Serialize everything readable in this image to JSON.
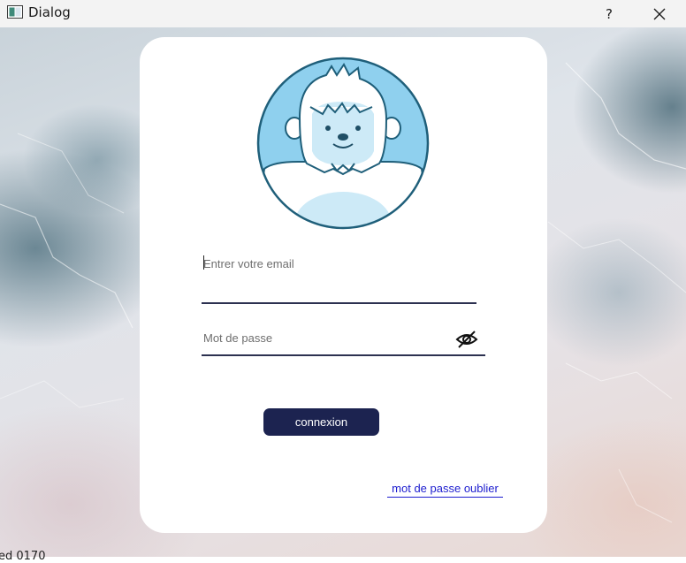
{
  "window": {
    "title": "Dialog",
    "help_label": "?",
    "app_icon": "window-app-icon",
    "close_icon": "close-icon"
  },
  "form": {
    "avatar": "yeti-avatar-icon",
    "email_placeholder": "Entrer votre email",
    "email_value": "",
    "password_placeholder": "Mot de passe",
    "password_value": "",
    "password_toggle_icon": "eye-off-icon",
    "connect_label": "connexion",
    "forgot_label": "mot de passe oublier"
  },
  "status": {
    "bottom_text": "ed 0170"
  },
  "colors": {
    "button_bg": "#1c2350",
    "link": "#1d1dcf",
    "underline": "#2c3150",
    "avatar_blue": "#8fd0ee",
    "avatar_outline": "#1f5f7a"
  }
}
